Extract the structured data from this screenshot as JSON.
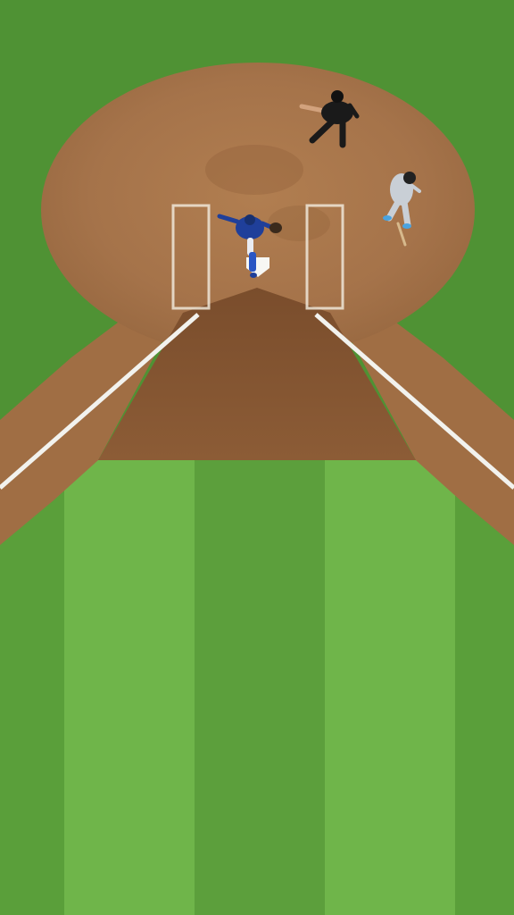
{
  "scene": {
    "subject": "baseball-home-plate-aerial",
    "colors": {
      "grass_light": "#6fb54a",
      "grass_dark": "#5a9f3a",
      "grass_outer": "#4f9234",
      "dirt": "#a9774a",
      "dirt_dark": "#8a5a34",
      "chalk": "#f2f2ee",
      "catcher_blue": "#1f3f9a",
      "umpire_black": "#1a1a1a",
      "batter_grey": "#c9cfd6",
      "batter_accent": "#4aa3e0"
    },
    "figures": [
      {
        "role": "catcher"
      },
      {
        "role": "umpire"
      },
      {
        "role": "batter"
      }
    ]
  }
}
